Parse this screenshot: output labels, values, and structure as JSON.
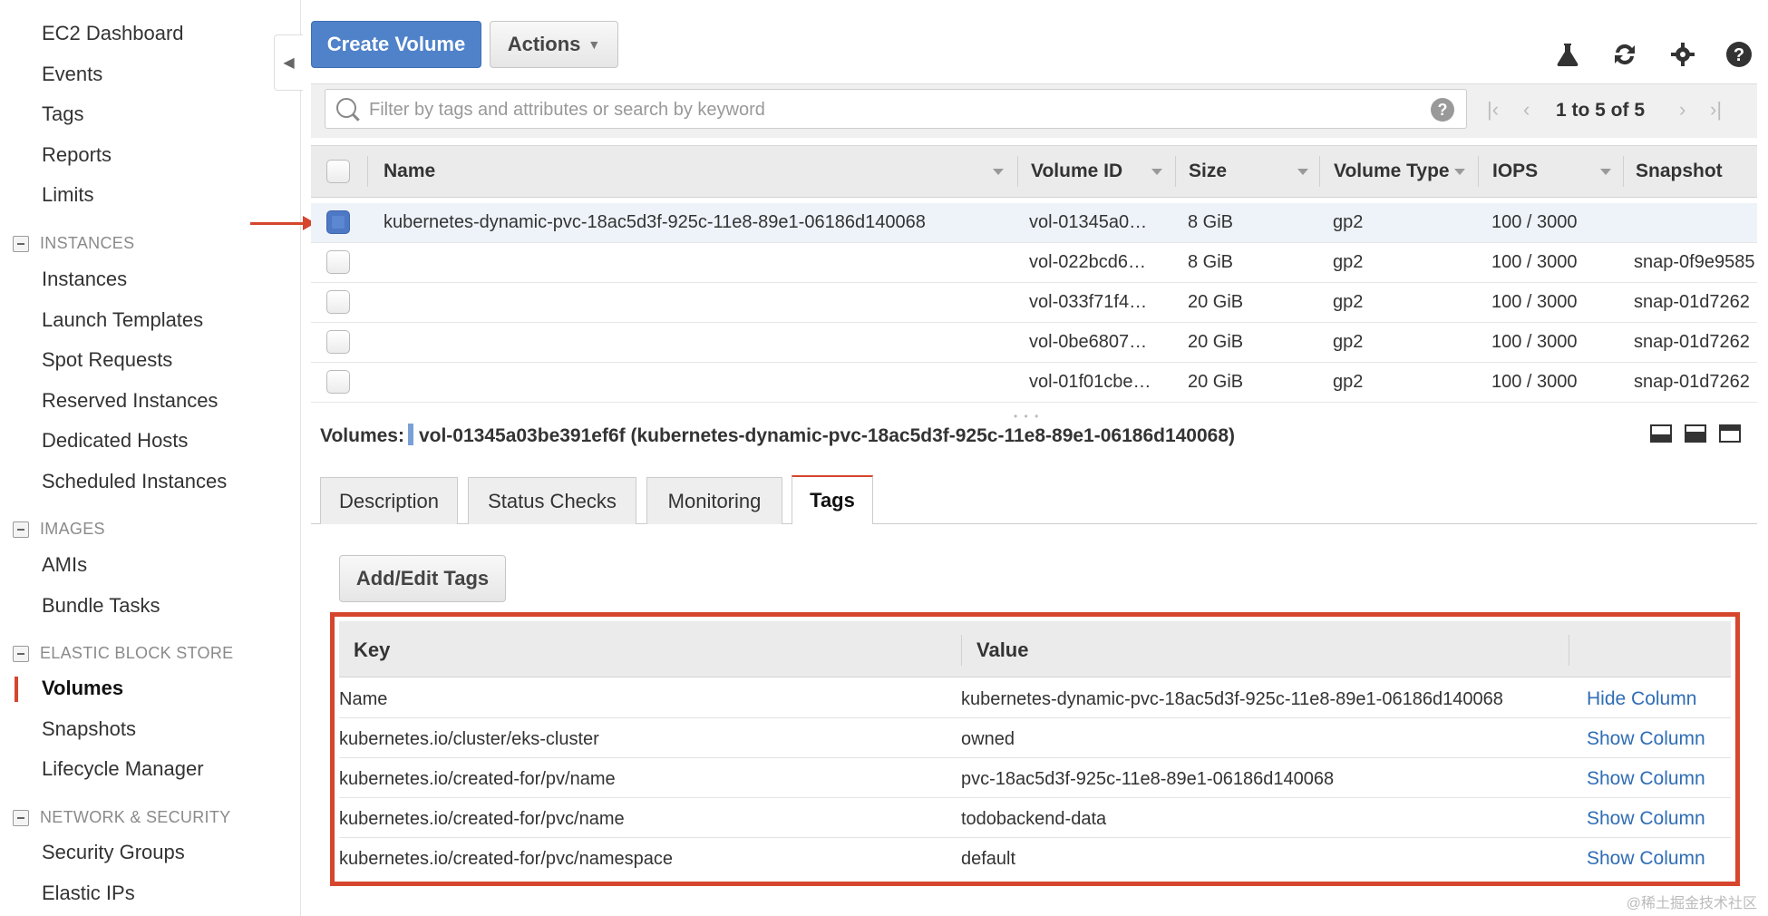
{
  "sidebar": {
    "top_items": [
      "EC2 Dashboard",
      "Events",
      "Tags",
      "Reports",
      "Limits"
    ],
    "sections": [
      {
        "title": "INSTANCES",
        "items": [
          "Instances",
          "Launch Templates",
          "Spot Requests",
          "Reserved Instances",
          "Dedicated Hosts",
          "Scheduled Instances"
        ]
      },
      {
        "title": "IMAGES",
        "items": [
          "AMIs",
          "Bundle Tasks"
        ]
      },
      {
        "title": "ELASTIC BLOCK STORE",
        "items": [
          "Volumes",
          "Snapshots",
          "Lifecycle Manager"
        ]
      },
      {
        "title": "NETWORK & SECURITY",
        "items": [
          "Security Groups",
          "Elastic IPs"
        ]
      }
    ],
    "active_item": "Volumes"
  },
  "toolbar": {
    "create_label": "Create Volume",
    "actions_label": "Actions"
  },
  "filter": {
    "placeholder": "Filter by tags and attributes or search by keyword",
    "pager_text": "1 to 5 of 5"
  },
  "grid": {
    "columns": [
      "Name",
      "Volume ID",
      "Size",
      "Volume Type",
      "IOPS",
      "Snapshot"
    ],
    "rows": [
      {
        "name": "kubernetes-dynamic-pvc-18ac5d3f-925c-11e8-89e1-06186d140068",
        "volume_id": "vol-01345a0…",
        "size": "8 GiB",
        "type": "gp2",
        "iops": "100 / 3000",
        "snapshot": "",
        "selected": true
      },
      {
        "name": "",
        "volume_id": "vol-022bcd6…",
        "size": "8 GiB",
        "type": "gp2",
        "iops": "100 / 3000",
        "snapshot": "snap-0f9e9585",
        "selected": false
      },
      {
        "name": "",
        "volume_id": "vol-033f71f4…",
        "size": "20 GiB",
        "type": "gp2",
        "iops": "100 / 3000",
        "snapshot": "snap-01d7262",
        "selected": false
      },
      {
        "name": "",
        "volume_id": "vol-0be6807…",
        "size": "20 GiB",
        "type": "gp2",
        "iops": "100 / 3000",
        "snapshot": "snap-01d7262",
        "selected": false
      },
      {
        "name": "",
        "volume_id": "vol-01f01cbe…",
        "size": "20 GiB",
        "type": "gp2",
        "iops": "100 / 3000",
        "snapshot": "snap-01d7262",
        "selected": false
      }
    ]
  },
  "details": {
    "label": "Volumes:",
    "title": "vol-01345a03be391ef6f (kubernetes-dynamic-pvc-18ac5d3f-925c-11e8-89e1-06186d140068)",
    "tabs": [
      "Description",
      "Status Checks",
      "Monitoring",
      "Tags"
    ],
    "active_tab": "Tags",
    "add_edit_label": "Add/Edit Tags",
    "tags_header": {
      "key": "Key",
      "value": "Value"
    },
    "tags": [
      {
        "key": "Name",
        "value": "kubernetes-dynamic-pvc-18ac5d3f-925c-11e8-89e1-06186d140068",
        "action": "Hide Column"
      },
      {
        "key": "kubernetes.io/cluster/eks-cluster",
        "value": "owned",
        "action": "Show Column"
      },
      {
        "key": "kubernetes.io/created-for/pv/name",
        "value": "pvc-18ac5d3f-925c-11e8-89e1-06186d140068",
        "action": "Show Column"
      },
      {
        "key": "kubernetes.io/created-for/pvc/name",
        "value": "todobackend-data",
        "action": "Show Column"
      },
      {
        "key": "kubernetes.io/created-for/pvc/namespace",
        "value": "default",
        "action": "Show Column"
      }
    ]
  },
  "watermark": "@稀土掘金技术社区",
  "colors": {
    "primary": "#4f82c9",
    "highlight": "#d5462d",
    "link": "#2f6db5"
  }
}
